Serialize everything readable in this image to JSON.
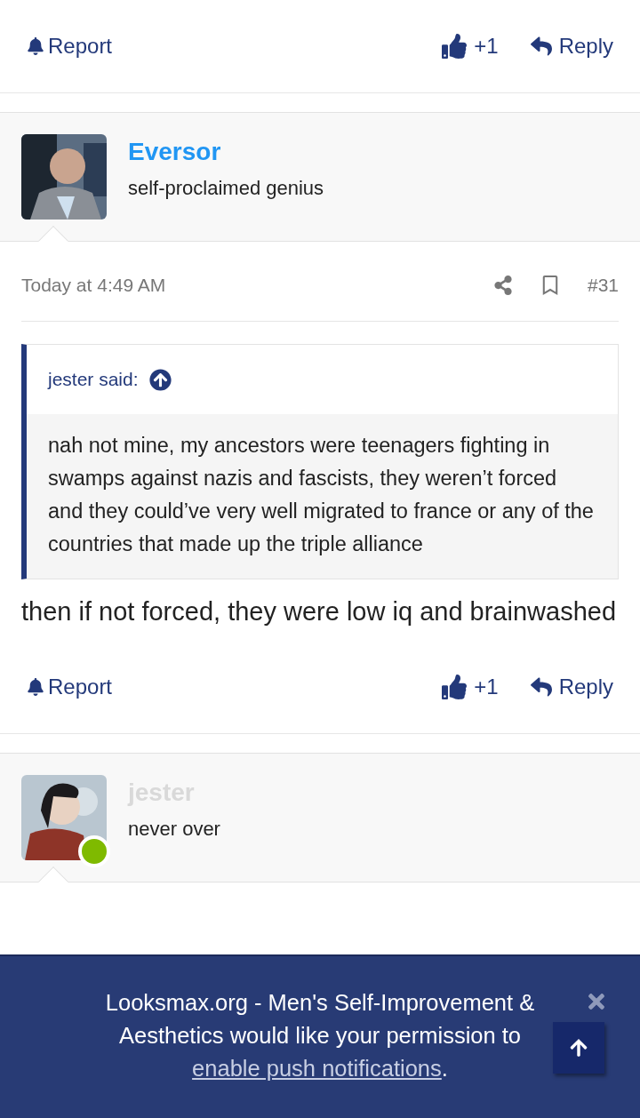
{
  "top_actions": {
    "report": "Report",
    "likes": "+1",
    "reply": "Reply"
  },
  "post": {
    "author": {
      "name": "Eversor",
      "title": "self-proclaimed genius",
      "online": false
    },
    "date": "Today at 4:49 AM",
    "number": "#31",
    "quote": {
      "author": "jester said:",
      "text": "nah not mine, my ancestors were teenagers fighting in swamps against nazis and fascists, they weren’t forced and they could’ve very well migrated to france or any of the countries that made up the triple alliance"
    },
    "body": "then if not forced, they were low iq and brainwashed",
    "actions": {
      "report": "Report",
      "likes": "+1",
      "reply": "Reply"
    }
  },
  "next_post": {
    "author": {
      "name": "jester",
      "title": "never over",
      "online": true
    }
  },
  "notification": {
    "text": "Looksmax.org - Men's Self-Improvement & Aesthetics would like your permission to",
    "link": "enable push notifications",
    "after": "."
  }
}
